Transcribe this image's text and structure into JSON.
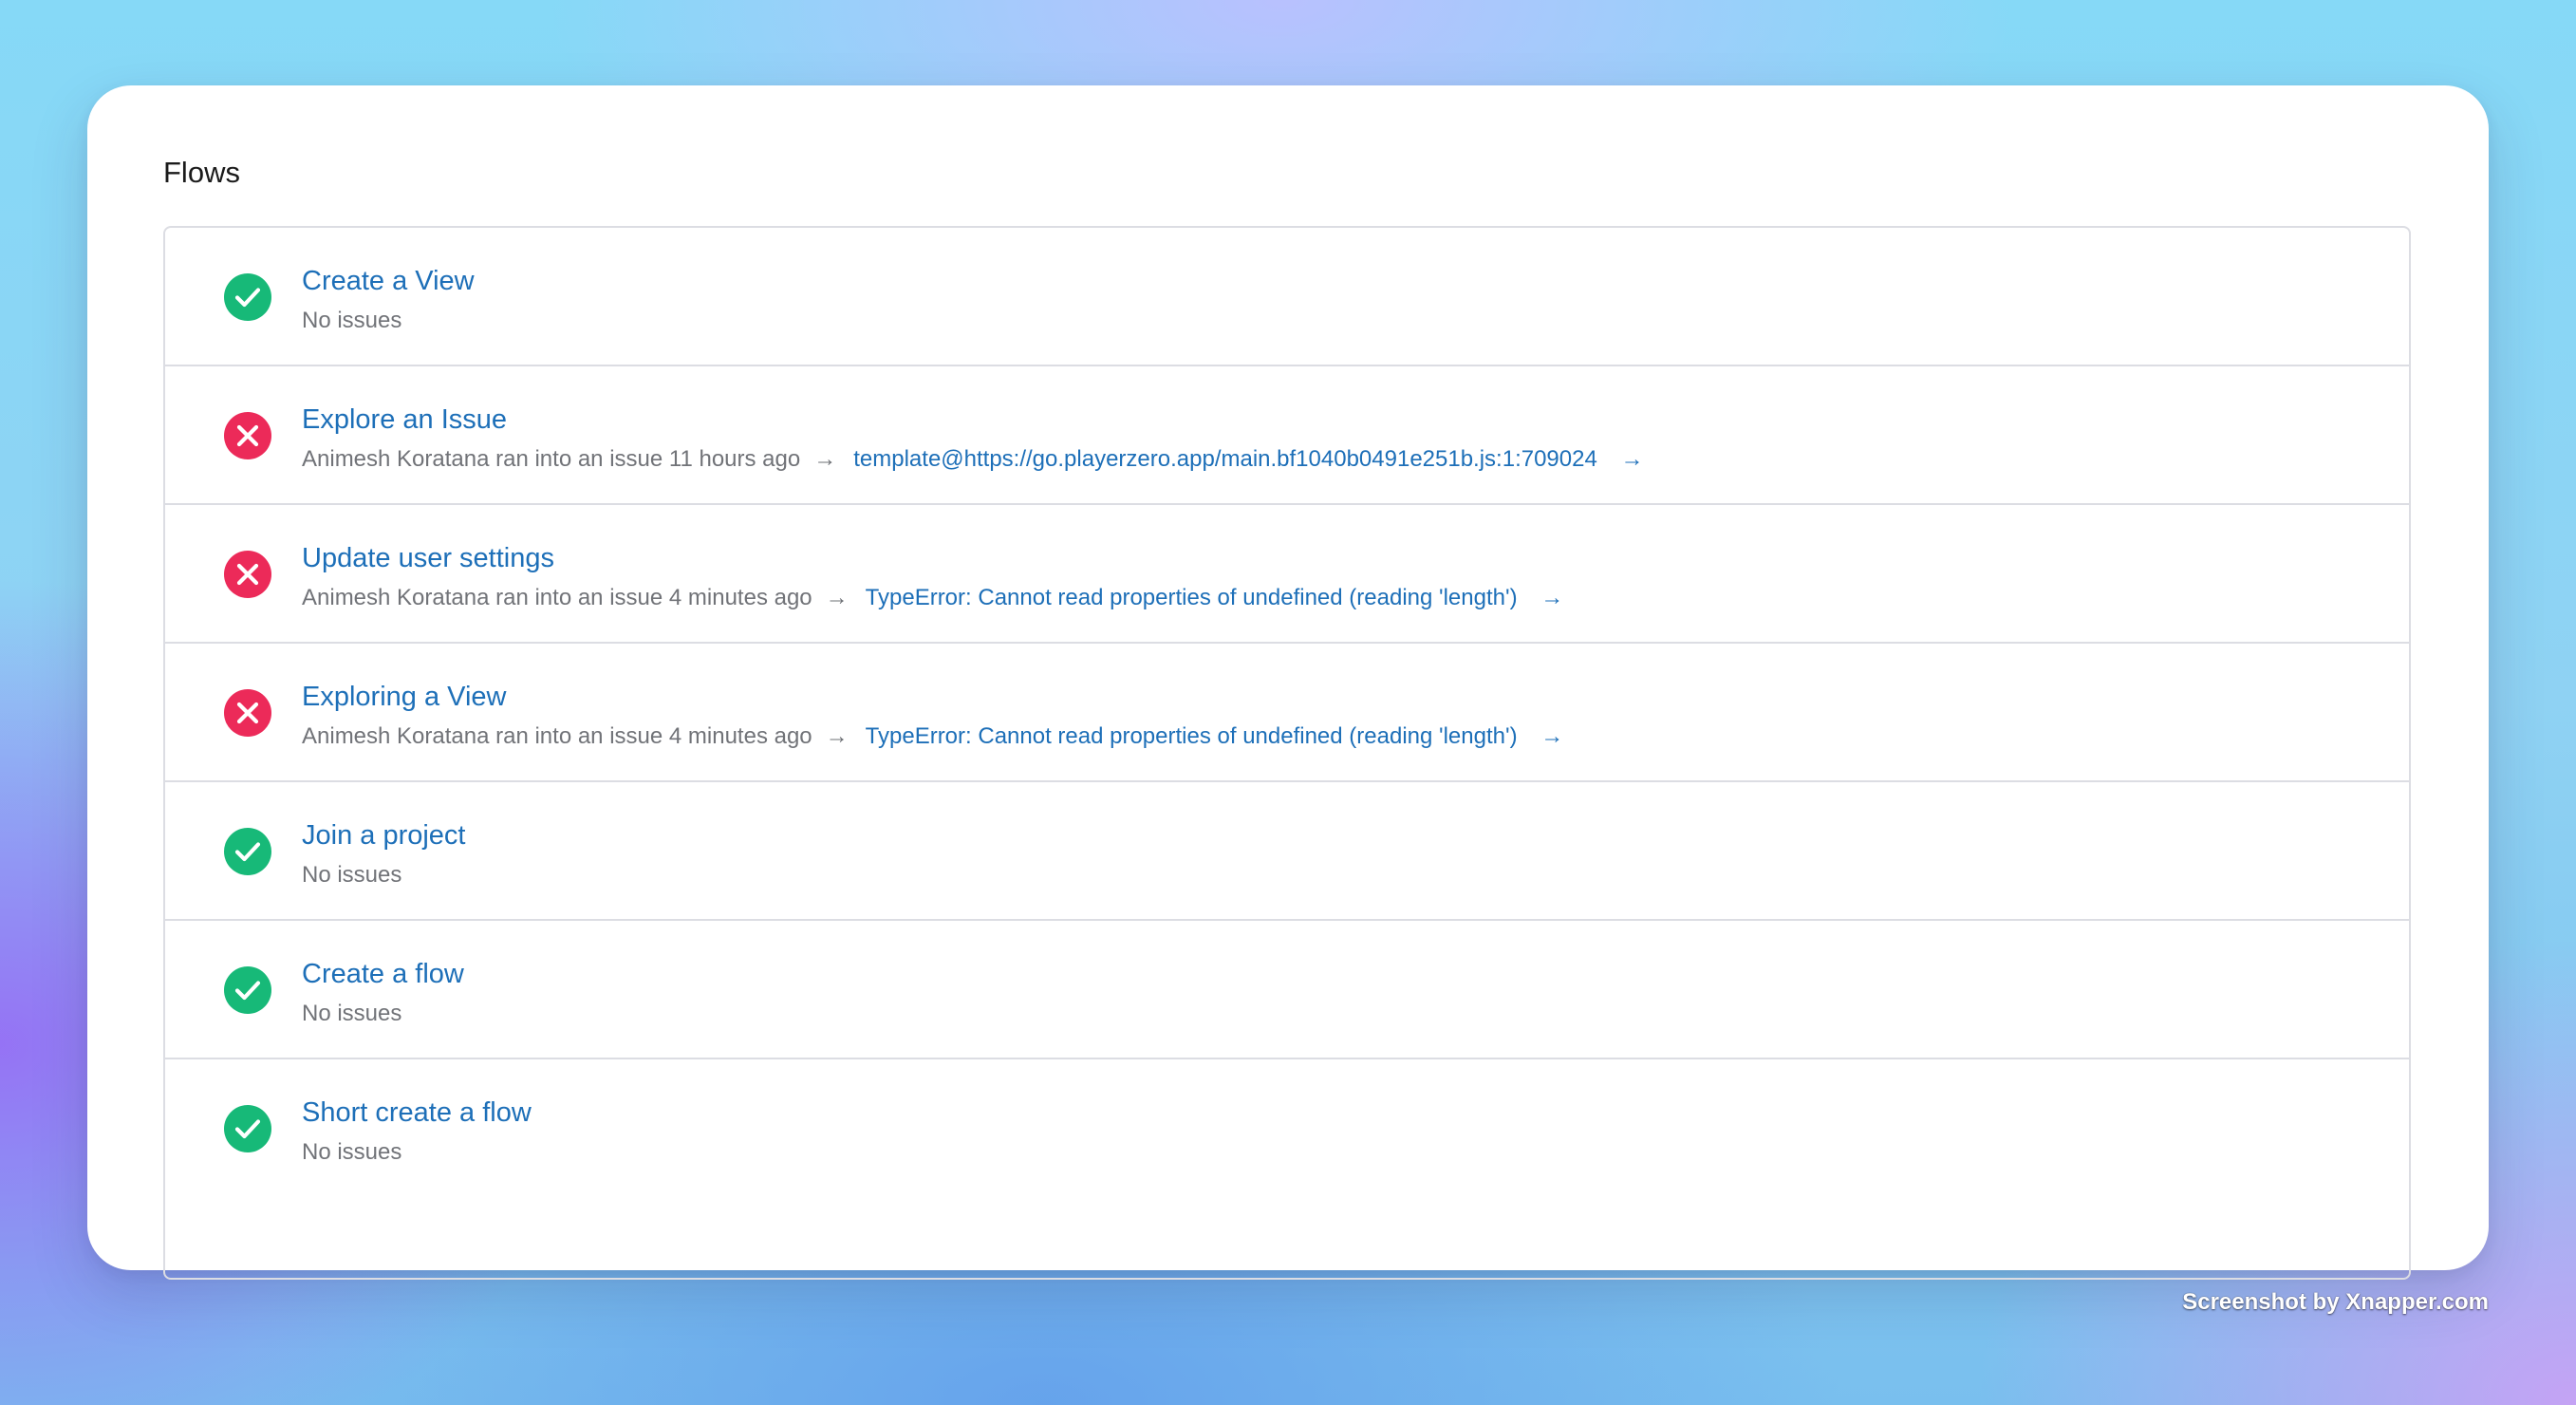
{
  "colors": {
    "success": "#17b978",
    "error": "#ec2a59",
    "link": "#1d6fb8",
    "muted": "#717378"
  },
  "page": {
    "title": "Flows"
  },
  "flows": [
    {
      "name": "Create a View",
      "status": "success",
      "status_icon": "check-circle-icon",
      "meta": "No issues"
    },
    {
      "name": "Explore an Issue",
      "status": "error",
      "status_icon": "x-circle-icon",
      "meta": "Animesh Koratana ran into an issue 11 hours ago",
      "arrow": "→",
      "error": "template@https://go.playerzero.app/main.bf1040b0491e251b.js:1:709024",
      "error_arrow": "→"
    },
    {
      "name": "Update user settings",
      "status": "error",
      "status_icon": "x-circle-icon",
      "meta": "Animesh Koratana ran into an issue 4 minutes ago",
      "arrow": "→",
      "error": "TypeError: Cannot read properties of undefined (reading 'length')",
      "error_arrow": "→"
    },
    {
      "name": "Exploring a View",
      "status": "error",
      "status_icon": "x-circle-icon",
      "meta": "Animesh Koratana ran into an issue 4 minutes ago",
      "arrow": "→",
      "error": "TypeError: Cannot read properties of undefined (reading 'length')",
      "error_arrow": "→"
    },
    {
      "name": "Join a project",
      "status": "success",
      "status_icon": "check-circle-icon",
      "meta": "No issues"
    },
    {
      "name": "Create a flow",
      "status": "success",
      "status_icon": "check-circle-icon",
      "meta": "No issues"
    },
    {
      "name": "Short create a flow",
      "status": "success",
      "status_icon": "check-circle-icon",
      "meta": "No issues"
    }
  ],
  "watermark": "Screenshot by Xnapper.com"
}
